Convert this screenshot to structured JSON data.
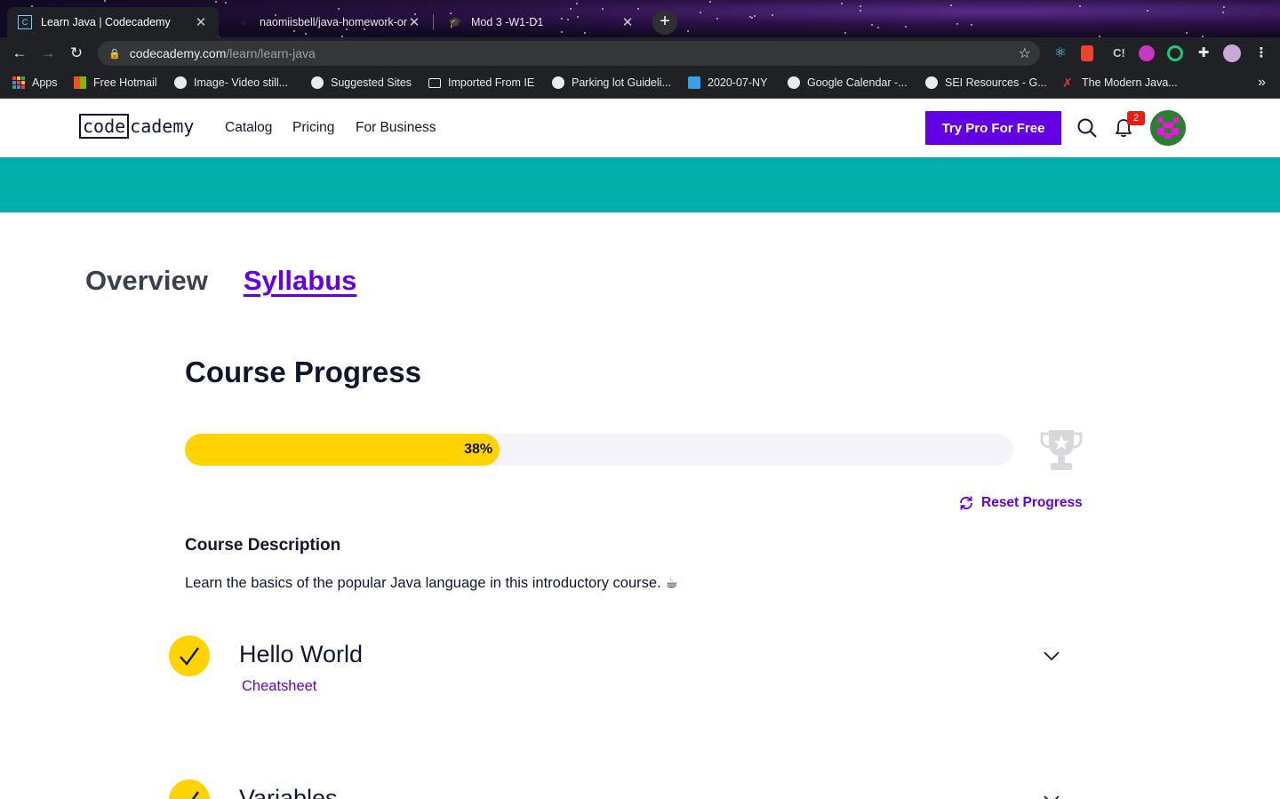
{
  "browser": {
    "tabs": [
      {
        "title": "Learn Java | Codecademy",
        "active": true
      },
      {
        "title": "naomiisbell/java-homework-on",
        "active": false
      },
      {
        "title": "Mod 3 -W1-D1",
        "active": false
      }
    ],
    "url": {
      "domain": "codecademy.com",
      "path": "/learn/learn-java"
    },
    "bookmarks": [
      {
        "label": "Apps",
        "icon": "apps-grid-icon"
      },
      {
        "label": "Free Hotmail",
        "icon": "microsoft-icon"
      },
      {
        "label": "Image- Video still...",
        "icon": "globe-icon"
      },
      {
        "label": "Suggested Sites",
        "icon": "globe-icon"
      },
      {
        "label": "Imported From IE",
        "icon": "folder-icon"
      },
      {
        "label": "Parking lot Guideli...",
        "icon": "globe-icon"
      },
      {
        "label": "2020-07-NY",
        "icon": "graduation-cap-icon"
      },
      {
        "label": "Google Calendar -...",
        "icon": "globe-icon"
      },
      {
        "label": "SEI Resources - G...",
        "icon": "globe-icon"
      },
      {
        "label": "The Modern Java...",
        "icon": "figure-icon"
      }
    ]
  },
  "site": {
    "logo_box": "code",
    "logo_rest": "cademy",
    "nav": [
      "Catalog",
      "Pricing",
      "For Business"
    ],
    "cta": "Try Pro For Free",
    "notifications": "2",
    "brand_color": "#6400e4",
    "band_color": "#00aeaa"
  },
  "page": {
    "tabs": [
      {
        "label": "Overview",
        "active": false
      },
      {
        "label": "Syllabus",
        "active": true
      }
    ],
    "progress_heading": "Course Progress",
    "progress": {
      "label": "38%",
      "value": 0.38
    },
    "reset_label": "Reset Progress",
    "description_heading": "Course Description",
    "description": "Learn the basics of the popular Java language in this introductory course. ☕",
    "modules": [
      {
        "title": "Hello World",
        "link": "Cheatsheet",
        "completed": true
      },
      {
        "title": "Variables",
        "link": "",
        "completed": true
      }
    ]
  }
}
